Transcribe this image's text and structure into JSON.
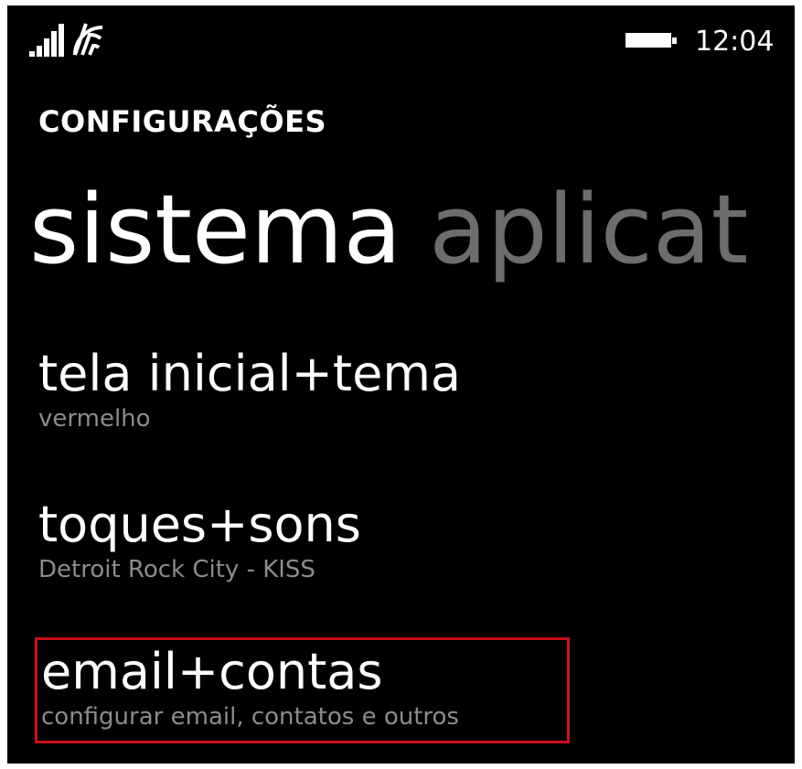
{
  "status_bar": {
    "signal_icon": "cellular-signal-icon",
    "wifi_icon": "wifi-icon",
    "battery_icon": "battery-icon",
    "time": "12:04"
  },
  "header": {
    "app_title": "CONFIGURAÇÕES",
    "pivot": {
      "active": "sistema",
      "next": "aplicat"
    }
  },
  "settings": [
    {
      "title": "tela inicial+tema",
      "subtitle": "vermelho"
    },
    {
      "title": "toques+sons",
      "subtitle": "Detroit Rock City - KISS"
    },
    {
      "title": "email+contas",
      "subtitle": "configurar email, contatos e outros",
      "highlighted": true
    }
  ],
  "colors": {
    "background": "#000000",
    "text": "#ffffff",
    "subtext": "#8c8c8c",
    "inactive_pivot": "#6d6d6d",
    "highlight_border": "#c8101a"
  }
}
